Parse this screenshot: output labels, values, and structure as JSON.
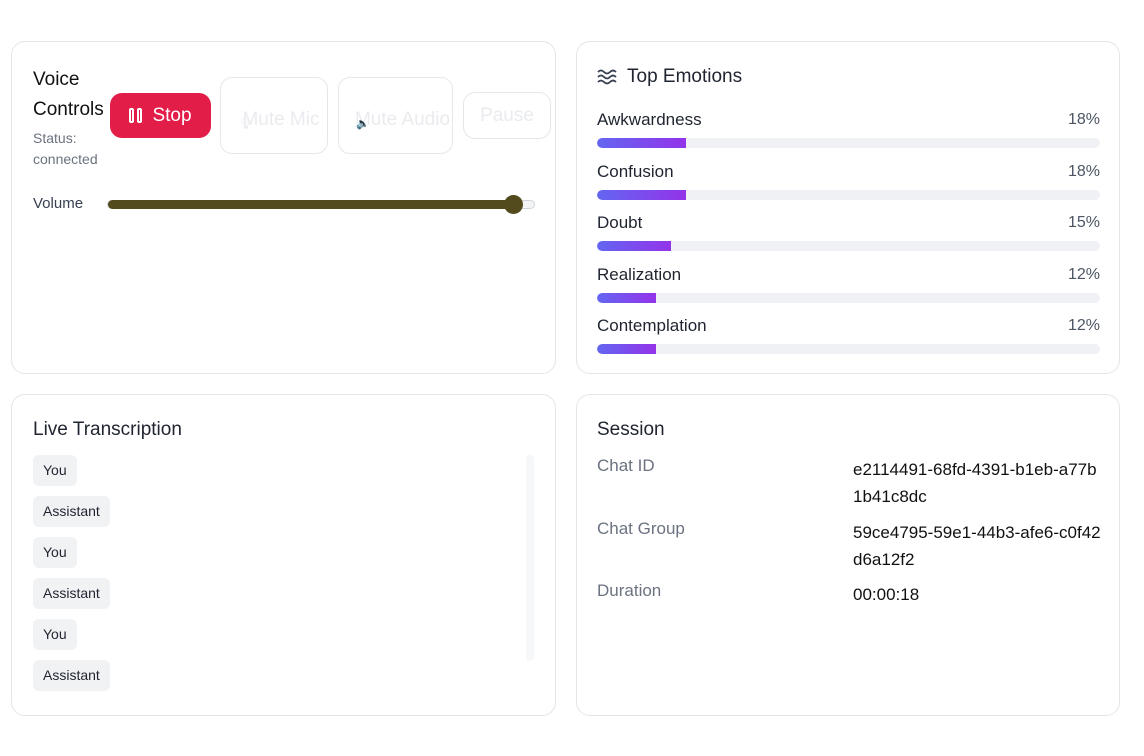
{
  "voice_controls": {
    "title": "Voice Controls",
    "status": "Status: connected",
    "stop_label": "Stop",
    "mute_mic_label": "Mute Mic",
    "mute_audio_label": "Mute Audio",
    "pause_label": "Pause",
    "volume_label": "Volume",
    "volume_level": 0.95,
    "stop_color": "#e11d48",
    "volume_color": "#534b1d"
  },
  "emotions": {
    "title": "Top Emotions",
    "icon": "waves-icon",
    "items": [
      {
        "name": "Awkwardness",
        "percent_label": "18%",
        "value": 18
      },
      {
        "name": "Confusion",
        "percent_label": "18%",
        "value": 18
      },
      {
        "name": "Doubt",
        "percent_label": "15%",
        "value": 15
      },
      {
        "name": "Realization",
        "percent_label": "12%",
        "value": 12
      },
      {
        "name": "Contemplation",
        "percent_label": "12%",
        "value": 12
      }
    ]
  },
  "transcription": {
    "title": "Live Transcription",
    "messages": [
      {
        "speaker": "You"
      },
      {
        "speaker": "Assistant"
      },
      {
        "speaker": "You"
      },
      {
        "speaker": "Assistant"
      },
      {
        "speaker": "You"
      },
      {
        "speaker": "Assistant"
      }
    ]
  },
  "session": {
    "title": "Session",
    "rows": [
      {
        "key": "Chat ID",
        "value": "e2114491-68fd-4391-b1eb-a77b1b41c8dc"
      },
      {
        "key": "Chat Group",
        "value": "59ce4795-59e1-44b3-afe6-c0f42d6a12f2"
      },
      {
        "key": "Duration",
        "value": "00:00:18"
      }
    ]
  }
}
